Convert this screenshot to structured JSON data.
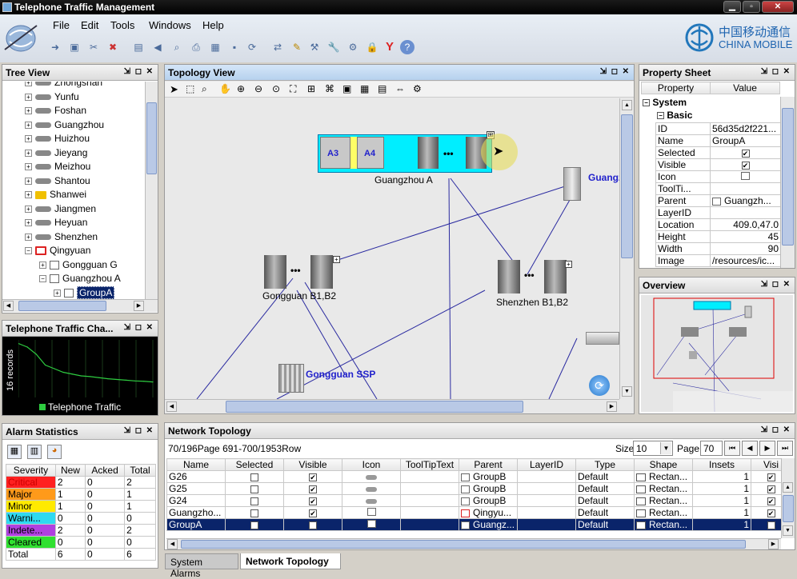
{
  "window": {
    "title": "Telephone Traffic Management"
  },
  "menu": [
    "File",
    "Edit",
    "Tools",
    "Windows",
    "Help"
  ],
  "logo": {
    "cn": "中国移动通信",
    "en": "CHINA MOBILE"
  },
  "tree": {
    "title": "Tree View",
    "items": [
      {
        "label": "Zhongshan"
      },
      {
        "label": "Yunfu"
      },
      {
        "label": "Foshan"
      },
      {
        "label": "Guangzhou"
      },
      {
        "label": "Huizhou"
      },
      {
        "label": "Jieyang"
      },
      {
        "label": "Meizhou"
      },
      {
        "label": "Shantou"
      },
      {
        "label": "Shanwei"
      },
      {
        "label": "Jiangmen"
      },
      {
        "label": "Heyuan"
      },
      {
        "label": "Shenzhen"
      },
      {
        "label": "Qingyuan"
      },
      {
        "label": "Gongguan G"
      },
      {
        "label": "Guangzhou A"
      },
      {
        "label": "GroupA"
      }
    ]
  },
  "chart": {
    "title": "Telephone Traffic Cha...",
    "ylabel": "16 records",
    "legend": "Telephone Traffic"
  },
  "chart_data": {
    "type": "line",
    "series": [
      {
        "name": "Telephone Traffic",
        "values": [
          15,
          14,
          12,
          9,
          8,
          7,
          6.5,
          6,
          5.8,
          5.5,
          5.2,
          5,
          4.8,
          4.6,
          4.5,
          4.3
        ]
      }
    ]
  },
  "alarms": {
    "title": "Alarm Statistics",
    "headers": [
      "Severity",
      "New",
      "Acked",
      "Total"
    ],
    "rows": [
      {
        "severity": "Critical",
        "new": "2",
        "acked": "0",
        "total": "2",
        "color": "#ff2020"
      },
      {
        "severity": "Major",
        "new": "1",
        "acked": "0",
        "total": "1",
        "color": "#ff9a1a"
      },
      {
        "severity": "Minor",
        "new": "1",
        "acked": "0",
        "total": "1",
        "color": "#ffea00"
      },
      {
        "severity": "Warni...",
        "new": "0",
        "acked": "0",
        "total": "0",
        "color": "#2fd9f0"
      },
      {
        "severity": "Indete...",
        "new": "2",
        "acked": "0",
        "total": "2",
        "color": "#b040e0"
      },
      {
        "severity": "Cleared",
        "new": "0",
        "acked": "0",
        "total": "0",
        "color": "#30e030"
      },
      {
        "severity": "Total",
        "new": "6",
        "acked": "0",
        "total": "6",
        "color": "#ffffff"
      }
    ]
  },
  "topology": {
    "title": "Topology View",
    "nodes": {
      "group": "Guangzhou A",
      "a3": "A3",
      "a4": "A4",
      "gongguan": "Gongguan B1,B2",
      "shenzhen": "Shenzhen B1,B2",
      "ssp": "Gongguan SSP",
      "guangz": "Guangz"
    }
  },
  "property": {
    "title": "Property Sheet",
    "headers": [
      "Property",
      "Value"
    ],
    "sections": {
      "system": "System",
      "basic": "Basic"
    },
    "rows": [
      {
        "name": "ID",
        "value": "56d35d2f221..."
      },
      {
        "name": "Name",
        "value": "GroupA"
      },
      {
        "name": "Selected",
        "value": "✔"
      },
      {
        "name": "Visible",
        "value": "✔"
      },
      {
        "name": "Icon",
        "value": ""
      },
      {
        "name": "ToolTi...",
        "value": ""
      },
      {
        "name": "Parent",
        "value": "Guangzh..."
      },
      {
        "name": "LayerID",
        "value": ""
      },
      {
        "name": "Location",
        "value": "409.0,47.0"
      },
      {
        "name": "Height",
        "value": "45"
      },
      {
        "name": "Width",
        "value": "90"
      },
      {
        "name": "Image",
        "value": "/resources/ic..."
      }
    ]
  },
  "overview": {
    "title": "Overview"
  },
  "network": {
    "title": "Network Topology",
    "pager": "70/196Page 691-700/1953Row",
    "size_label": "Size",
    "size_value": "10",
    "page_label": "Page",
    "page_value": "70",
    "headers": [
      "Name",
      "Selected",
      "Visible",
      "Icon",
      "ToolTipText",
      "Parent",
      "LayerID",
      "Type",
      "Shape",
      "Insets",
      "Visi"
    ],
    "rows": [
      {
        "name": "G26",
        "selected": false,
        "visible": true,
        "parent": "GroupB",
        "type": "Default",
        "shape": "Rectan...",
        "insets": "1",
        "sel": false
      },
      {
        "name": "G25",
        "selected": false,
        "visible": true,
        "parent": "GroupB",
        "type": "Default",
        "shape": "Rectan...",
        "insets": "1",
        "sel": false
      },
      {
        "name": "G24",
        "selected": false,
        "visible": true,
        "parent": "GroupB",
        "type": "Default",
        "shape": "Rectan...",
        "insets": "1",
        "sel": false
      },
      {
        "name": "Guangzho...",
        "selected": false,
        "visible": true,
        "parent": "Qingyu...",
        "type": "Default",
        "shape": "Rectan...",
        "insets": "1",
        "sel": false
      },
      {
        "name": "GroupA",
        "selected": true,
        "visible": true,
        "parent": "Guangz...",
        "type": "Default",
        "shape": "Rectan...",
        "insets": "1",
        "sel": true
      }
    ]
  },
  "tabs": [
    "System Alarms",
    "Network Topology"
  ]
}
